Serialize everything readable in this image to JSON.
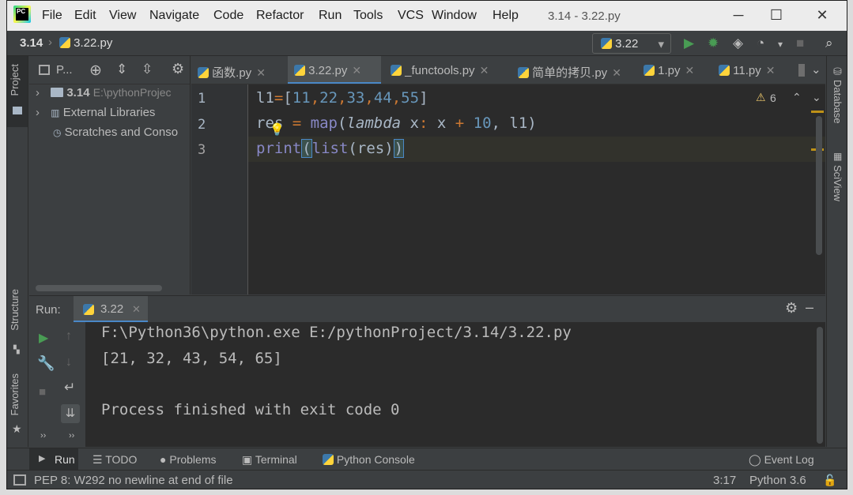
{
  "window": {
    "title": "3.14 - 3.22.py",
    "menu": [
      "File",
      "Edit",
      "View",
      "Navigate",
      "Code",
      "Refactor",
      "Run",
      "Tools",
      "VCS",
      "Window",
      "Help"
    ],
    "controls": {
      "minimize": "─",
      "maximize": "☐",
      "close": "✕"
    }
  },
  "navbar": {
    "breadcrumb_project": "3.14",
    "breadcrumb_file": "3.22.py",
    "run_config": "3.22"
  },
  "left_stripe": {
    "project": "Project",
    "structure": "Structure",
    "favorites": "Favorites"
  },
  "right_stripe": {
    "database": "Database",
    "sciview": "SciView"
  },
  "project_panel": {
    "title": "P...",
    "items": [
      {
        "label": "3.14",
        "path": "E:\\pythonProjec"
      },
      {
        "label": "External Libraries"
      },
      {
        "label": "Scratches and Conso"
      }
    ]
  },
  "tabs": [
    {
      "label": "函数.py"
    },
    {
      "label": "3.22.py"
    },
    {
      "label": "_functools.py"
    },
    {
      "label": "简单的拷贝.py"
    },
    {
      "label": "1.py"
    },
    {
      "label": "11.py"
    }
  ],
  "editor": {
    "line_numbers": [
      "1",
      "2",
      "3"
    ],
    "warnings_count": "6",
    "line1": {
      "a": "l1",
      "b": "=",
      "c": "[",
      "n1": "11",
      "n2": "22",
      "n3": "33",
      "n4": "44",
      "n5": "55",
      "d": "]",
      "comma": ","
    },
    "line2": {
      "a": "res ",
      "eq": "=",
      "map": " map",
      "paren": "(",
      "lambda": "lambda",
      "x1": " x",
      "colon": ":",
      "x2": " x ",
      "plus": "+",
      "ten": " 10",
      "rest": ", l1)"
    },
    "line3": {
      "print": "print",
      "p1": "(",
      "list": "list",
      "p2": "(",
      "res": "res",
      "p3": ")",
      "p4": ")"
    }
  },
  "run": {
    "label": "Run:",
    "tab": "3.22",
    "output": [
      "F:\\Python36\\python.exe E:/pythonProject/3.14/3.22.py",
      "[21, 32, 43, 54, 65]",
      "",
      "Process finished with exit code 0"
    ]
  },
  "bottom_tools": [
    "Run",
    "TODO",
    "Problems",
    "Terminal",
    "Python Console",
    "Event Log"
  ],
  "status": {
    "message": "PEP 8: W292 no newline at end of file",
    "position": "3:17",
    "interpreter": "Python 3.6"
  }
}
